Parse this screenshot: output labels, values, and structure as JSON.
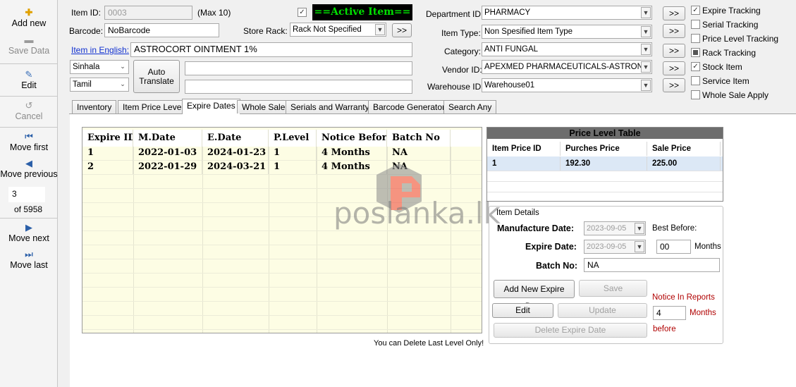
{
  "sidebar": {
    "add_new": "Add new",
    "save_data": "Save Data",
    "edit": "Edit",
    "cancel": "Cancel",
    "move_first": "Move first",
    "move_previous": "Move previous",
    "record_position": "3",
    "record_total": "of 5958",
    "move_next": "Move next",
    "move_last": "Move last"
  },
  "form": {
    "item_id_label": "Item ID:",
    "item_id_value": "0003",
    "item_id_max": "(Max 10)",
    "active_item": "==Active Item==",
    "barcode_label": "Barcode:",
    "barcode_value": "NoBarcode",
    "store_rack_label": "Store Rack:",
    "store_rack_value": "Rack Not Specified",
    "item_english_label": "Item in English:",
    "item_english_value": "ASTROCORT OINTMENT 1%",
    "lang1": "Sinhala",
    "lang2": "Tamil",
    "auto_translate": "Auto Translate",
    "lang1_value": "",
    "lang2_value": "",
    "department_label": "Department ID:",
    "department_value": "PHARMACY",
    "item_type_label": "Item Type:",
    "item_type_value": "Non Spesified Item Type",
    "category_label": "Category:",
    "category_value": "ANTI FUNGAL",
    "vendor_label": "Vendor ID:",
    "vendor_value": "APEXMED PHARMACEUTICALS-ASTRON",
    "warehouse_label": "Warehouse ID:",
    "warehouse_value": "Warehouse01",
    "more_button": ">>"
  },
  "checkboxes": [
    {
      "label": "Expire Tracking",
      "state": "checked"
    },
    {
      "label": "Serial Tracking",
      "state": "unchecked"
    },
    {
      "label": "Price Level Tracking",
      "state": "unchecked"
    },
    {
      "label": "Rack Tracking",
      "state": "indeterminate"
    },
    {
      "label": "Stock Item",
      "state": "checked"
    },
    {
      "label": "Service Item",
      "state": "unchecked"
    },
    {
      "label": "Whole Sale Apply",
      "state": "unchecked"
    }
  ],
  "tabs": [
    "Inventory",
    "Item Price Level",
    "Expire Dates",
    "Whole Sale",
    "Serials and Warranty",
    "Barcode Generator",
    "Search Any"
  ],
  "active_tab": "Expire Dates",
  "expire_grid": {
    "headers": [
      "Expire ID",
      "M.Date",
      "E.Date",
      "P.Level",
      "Notice Before",
      "Batch No"
    ],
    "rows": [
      [
        "1",
        "2022-01-03",
        "2024-01-23",
        "1",
        "4 Months",
        "NA"
      ],
      [
        "2",
        "2022-01-29",
        "2024-03-21",
        "1",
        "4 Months",
        "NA"
      ]
    ]
  },
  "delete_note": "You can Delete Last Level Only!",
  "price_table": {
    "title": "Price Level Table",
    "headers": [
      "Item Price ID",
      "Purches Price",
      "Sale Price"
    ],
    "rows": [
      [
        "1",
        "192.30",
        "225.00"
      ]
    ]
  },
  "item_details": {
    "title": "Item Details",
    "manufacture_label": "Manufacture Date:",
    "manufacture_value": "2023-09-05",
    "best_before_label": "Best Before:",
    "expire_label": "Expire Date:",
    "expire_value": "2023-09-05",
    "best_before_value": "00",
    "months_label": "Months",
    "batch_label": "Batch No:",
    "batch_value": "NA",
    "add_button": "Add New Expire Date",
    "save_button": "Save",
    "edit_button": "Edit",
    "update_button": "Update",
    "delete_button": "Delete Expire Date",
    "notice_label": "Notice In Reports",
    "notice_value": "4",
    "notice_months": "Months",
    "notice_before": "before"
  },
  "watermark": "poslanka.lk",
  "colors": {
    "active_item_bg": "#000000",
    "active_item_fg": "#00e000",
    "grid_bg": "#fdfde4",
    "notice_red": "#b00000",
    "price_header_bg": "#6d6d6d",
    "selected_row": "#dce8f6"
  }
}
